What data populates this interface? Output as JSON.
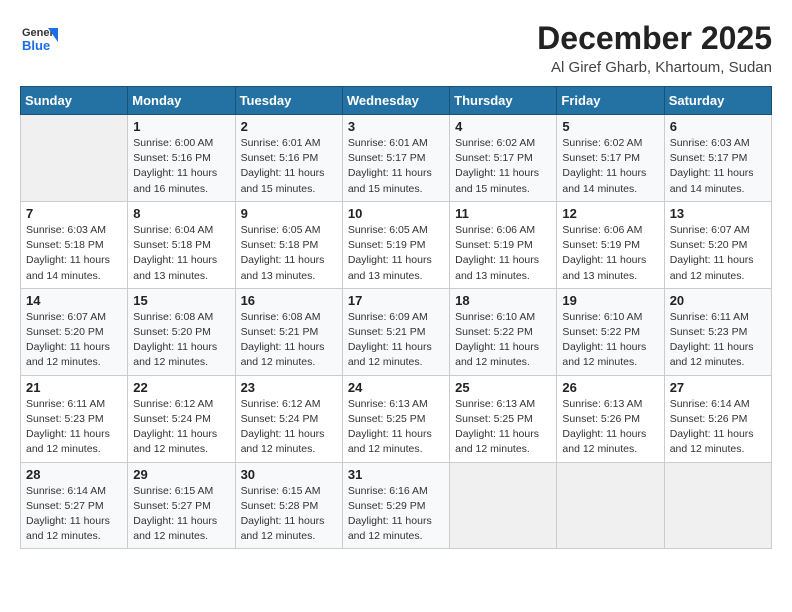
{
  "header": {
    "logo_general": "General",
    "logo_blue": "Blue",
    "month_year": "December 2025",
    "location": "Al Giref Gharb, Khartoum, Sudan"
  },
  "days_of_week": [
    "Sunday",
    "Monday",
    "Tuesday",
    "Wednesday",
    "Thursday",
    "Friday",
    "Saturday"
  ],
  "weeks": [
    [
      {
        "day": "",
        "sunrise": "",
        "sunset": "",
        "daylight": ""
      },
      {
        "day": "1",
        "sunrise": "Sunrise: 6:00 AM",
        "sunset": "Sunset: 5:16 PM",
        "daylight": "Daylight: 11 hours and 16 minutes."
      },
      {
        "day": "2",
        "sunrise": "Sunrise: 6:01 AM",
        "sunset": "Sunset: 5:16 PM",
        "daylight": "Daylight: 11 hours and 15 minutes."
      },
      {
        "day": "3",
        "sunrise": "Sunrise: 6:01 AM",
        "sunset": "Sunset: 5:17 PM",
        "daylight": "Daylight: 11 hours and 15 minutes."
      },
      {
        "day": "4",
        "sunrise": "Sunrise: 6:02 AM",
        "sunset": "Sunset: 5:17 PM",
        "daylight": "Daylight: 11 hours and 15 minutes."
      },
      {
        "day": "5",
        "sunrise": "Sunrise: 6:02 AM",
        "sunset": "Sunset: 5:17 PM",
        "daylight": "Daylight: 11 hours and 14 minutes."
      },
      {
        "day": "6",
        "sunrise": "Sunrise: 6:03 AM",
        "sunset": "Sunset: 5:17 PM",
        "daylight": "Daylight: 11 hours and 14 minutes."
      }
    ],
    [
      {
        "day": "7",
        "sunrise": "Sunrise: 6:03 AM",
        "sunset": "Sunset: 5:18 PM",
        "daylight": "Daylight: 11 hours and 14 minutes."
      },
      {
        "day": "8",
        "sunrise": "Sunrise: 6:04 AM",
        "sunset": "Sunset: 5:18 PM",
        "daylight": "Daylight: 11 hours and 13 minutes."
      },
      {
        "day": "9",
        "sunrise": "Sunrise: 6:05 AM",
        "sunset": "Sunset: 5:18 PM",
        "daylight": "Daylight: 11 hours and 13 minutes."
      },
      {
        "day": "10",
        "sunrise": "Sunrise: 6:05 AM",
        "sunset": "Sunset: 5:19 PM",
        "daylight": "Daylight: 11 hours and 13 minutes."
      },
      {
        "day": "11",
        "sunrise": "Sunrise: 6:06 AM",
        "sunset": "Sunset: 5:19 PM",
        "daylight": "Daylight: 11 hours and 13 minutes."
      },
      {
        "day": "12",
        "sunrise": "Sunrise: 6:06 AM",
        "sunset": "Sunset: 5:19 PM",
        "daylight": "Daylight: 11 hours and 13 minutes."
      },
      {
        "day": "13",
        "sunrise": "Sunrise: 6:07 AM",
        "sunset": "Sunset: 5:20 PM",
        "daylight": "Daylight: 11 hours and 12 minutes."
      }
    ],
    [
      {
        "day": "14",
        "sunrise": "Sunrise: 6:07 AM",
        "sunset": "Sunset: 5:20 PM",
        "daylight": "Daylight: 11 hours and 12 minutes."
      },
      {
        "day": "15",
        "sunrise": "Sunrise: 6:08 AM",
        "sunset": "Sunset: 5:20 PM",
        "daylight": "Daylight: 11 hours and 12 minutes."
      },
      {
        "day": "16",
        "sunrise": "Sunrise: 6:08 AM",
        "sunset": "Sunset: 5:21 PM",
        "daylight": "Daylight: 11 hours and 12 minutes."
      },
      {
        "day": "17",
        "sunrise": "Sunrise: 6:09 AM",
        "sunset": "Sunset: 5:21 PM",
        "daylight": "Daylight: 11 hours and 12 minutes."
      },
      {
        "day": "18",
        "sunrise": "Sunrise: 6:10 AM",
        "sunset": "Sunset: 5:22 PM",
        "daylight": "Daylight: 11 hours and 12 minutes."
      },
      {
        "day": "19",
        "sunrise": "Sunrise: 6:10 AM",
        "sunset": "Sunset: 5:22 PM",
        "daylight": "Daylight: 11 hours and 12 minutes."
      },
      {
        "day": "20",
        "sunrise": "Sunrise: 6:11 AM",
        "sunset": "Sunset: 5:23 PM",
        "daylight": "Daylight: 11 hours and 12 minutes."
      }
    ],
    [
      {
        "day": "21",
        "sunrise": "Sunrise: 6:11 AM",
        "sunset": "Sunset: 5:23 PM",
        "daylight": "Daylight: 11 hours and 12 minutes."
      },
      {
        "day": "22",
        "sunrise": "Sunrise: 6:12 AM",
        "sunset": "Sunset: 5:24 PM",
        "daylight": "Daylight: 11 hours and 12 minutes."
      },
      {
        "day": "23",
        "sunrise": "Sunrise: 6:12 AM",
        "sunset": "Sunset: 5:24 PM",
        "daylight": "Daylight: 11 hours and 12 minutes."
      },
      {
        "day": "24",
        "sunrise": "Sunrise: 6:13 AM",
        "sunset": "Sunset: 5:25 PM",
        "daylight": "Daylight: 11 hours and 12 minutes."
      },
      {
        "day": "25",
        "sunrise": "Sunrise: 6:13 AM",
        "sunset": "Sunset: 5:25 PM",
        "daylight": "Daylight: 11 hours and 12 minutes."
      },
      {
        "day": "26",
        "sunrise": "Sunrise: 6:13 AM",
        "sunset": "Sunset: 5:26 PM",
        "daylight": "Daylight: 11 hours and 12 minutes."
      },
      {
        "day": "27",
        "sunrise": "Sunrise: 6:14 AM",
        "sunset": "Sunset: 5:26 PM",
        "daylight": "Daylight: 11 hours and 12 minutes."
      }
    ],
    [
      {
        "day": "28",
        "sunrise": "Sunrise: 6:14 AM",
        "sunset": "Sunset: 5:27 PM",
        "daylight": "Daylight: 11 hours and 12 minutes."
      },
      {
        "day": "29",
        "sunrise": "Sunrise: 6:15 AM",
        "sunset": "Sunset: 5:27 PM",
        "daylight": "Daylight: 11 hours and 12 minutes."
      },
      {
        "day": "30",
        "sunrise": "Sunrise: 6:15 AM",
        "sunset": "Sunset: 5:28 PM",
        "daylight": "Daylight: 11 hours and 12 minutes."
      },
      {
        "day": "31",
        "sunrise": "Sunrise: 6:16 AM",
        "sunset": "Sunset: 5:29 PM",
        "daylight": "Daylight: 11 hours and 12 minutes."
      },
      {
        "day": "",
        "sunrise": "",
        "sunset": "",
        "daylight": ""
      },
      {
        "day": "",
        "sunrise": "",
        "sunset": "",
        "daylight": ""
      },
      {
        "day": "",
        "sunrise": "",
        "sunset": "",
        "daylight": ""
      }
    ]
  ]
}
